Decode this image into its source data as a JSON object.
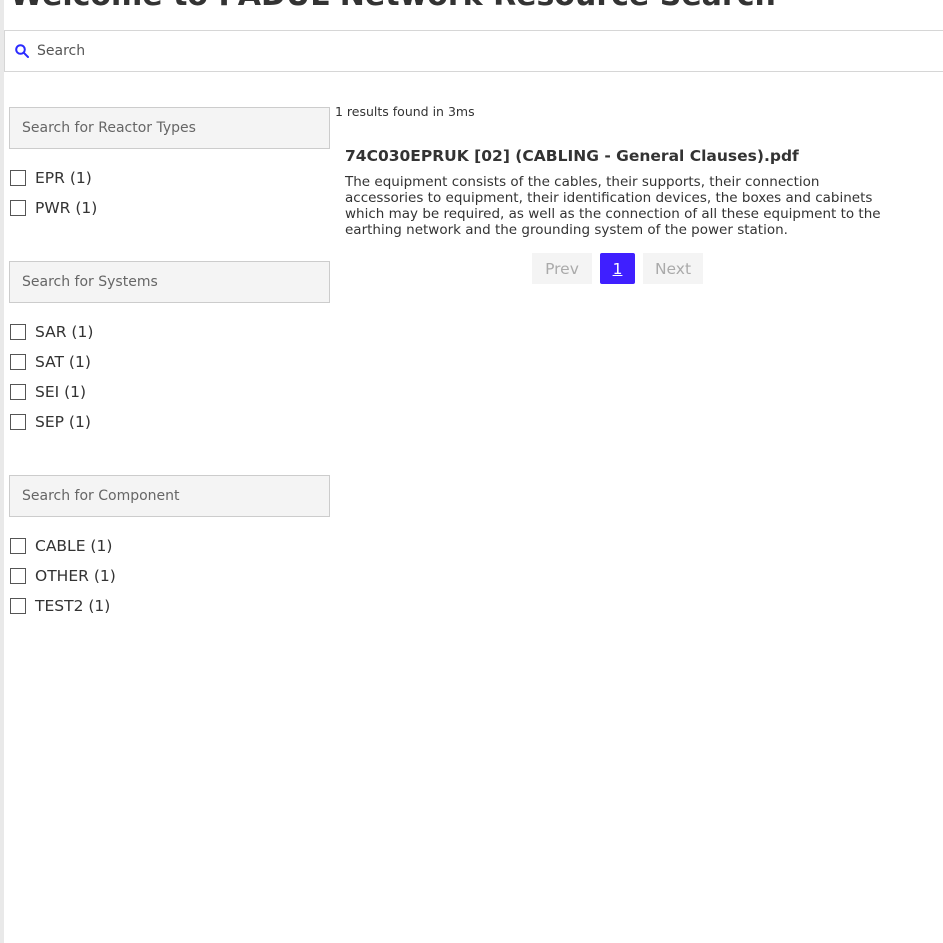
{
  "header": {
    "title": "Welcome to PADUL Network Resource Search"
  },
  "search": {
    "placeholder": "Search",
    "value": ""
  },
  "sidebar": {
    "groups": [
      {
        "placeholder": "Search for Reactor Types",
        "items": [
          {
            "label": "EPR (1)",
            "checked": false
          },
          {
            "label": "PWR (1)",
            "checked": false
          }
        ]
      },
      {
        "placeholder": "Search for Systems",
        "items": [
          {
            "label": "SAR (1)",
            "checked": false
          },
          {
            "label": "SAT (1)",
            "checked": false
          },
          {
            "label": "SEI (1)",
            "checked": false
          },
          {
            "label": "SEP (1)",
            "checked": false
          }
        ]
      },
      {
        "placeholder": "Search for Component",
        "items": [
          {
            "label": "CABLE (1)",
            "checked": false
          },
          {
            "label": "OTHER (1)",
            "checked": false
          },
          {
            "label": "TEST2 (1)",
            "checked": false
          }
        ]
      }
    ]
  },
  "results": {
    "summary": "1 results found in 3ms",
    "items": [
      {
        "title": "74C030EPRUK [02] (CABLING - General Clauses).pdf",
        "description": "The equipment consists of the cables, their supports, their connection accessories to equipment, their identification devices, the boxes and cabinets which may be required, as well as the connection of all these equipment to the earthing network and the grounding system of the power station."
      }
    ]
  },
  "pagination": {
    "prev_label": "Prev",
    "current_page": "1",
    "next_label": "Next"
  },
  "colors": {
    "accent": "#3f1fff",
    "icon": "#2a2aff"
  },
  "icons": {
    "search": "search-icon"
  }
}
